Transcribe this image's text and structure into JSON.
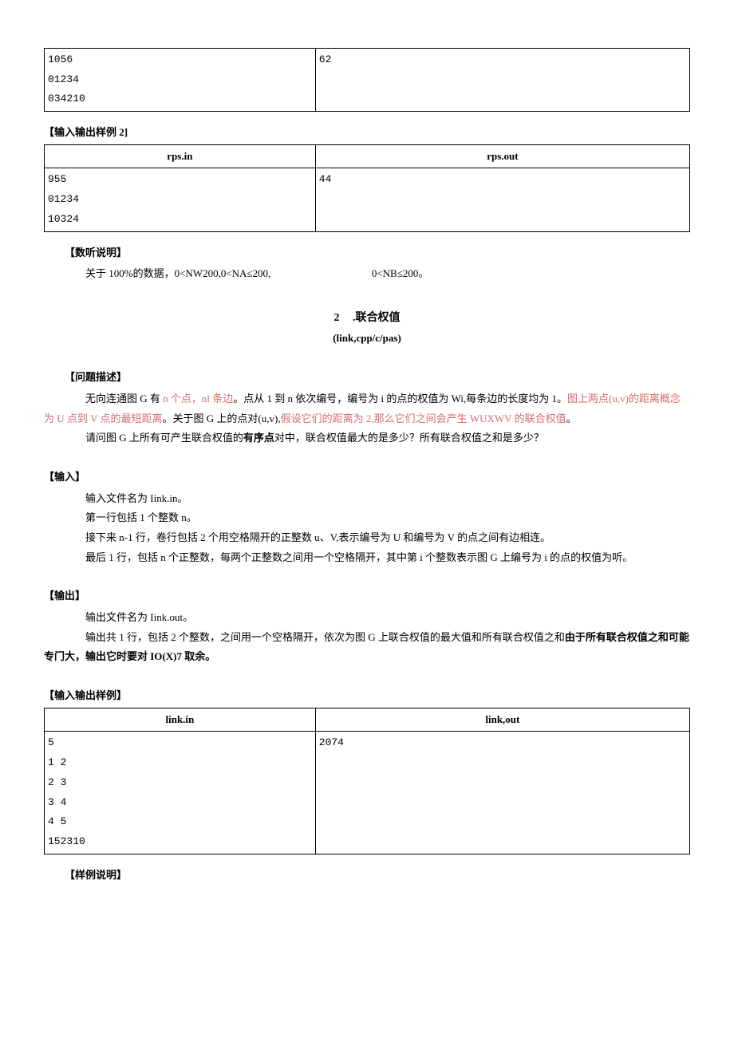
{
  "table1": {
    "in": "1056\n01234\n034210",
    "out": "62"
  },
  "sample2_label": "【输入输出样例 2]",
  "table2": {
    "header_in": "rps.in",
    "header_out": "rps.out",
    "in": "955\n01234\n10324",
    "out": "44"
  },
  "data_desc": {
    "label": "【数听说明】",
    "text_a": "关于 100%的数据，0<NW200,0<NA≤200,",
    "text_b": "0<NB≤200。"
  },
  "problem2": {
    "num": "2",
    "title": ".联合权值",
    "subtitle": "(link,cpp/c/pas)"
  },
  "desc": {
    "label": "【问题描述】",
    "p1a": "无向连通图 G 有 ",
    "p1b": "n 个点，nl 条边",
    "p1c": "。点从 1 到 n 依次编号，编号为 i 的点的权值为 Wi,每条边的长度均为 1。",
    "p1d": "图上两点(u,v)的距离概念为 U 点到 V 点的最短距离",
    "p1e": "。关于图 G 上的点对(u,v),",
    "p1f": "假设它们的距离为 2,那么它们之间会产生 WUXWV 的联合权值",
    "p1g": "。",
    "p2a": "请问图 G 上所有可产生联合权值的",
    "p2b": "有序点",
    "p2c": "对中，联合权值最大的是多少？所有联合权值之和是多少？"
  },
  "input": {
    "label": "【输入】",
    "l1": "输入文件名为 Iink.in。",
    "l2": "第一行包括 1 个整数 n。",
    "l3": "接下来 n-1 行，卷行包括 2 个用空格隔开的正整数 u、V,表示编号为 U 和编号为 V 的点之间有边相连。",
    "l4": "最后 1 行，包括 n 个正整数，每两个正整数之间用一个空格隔开，其中第 i 个整数表示图 G 上编号为 i 的点的权值为听。"
  },
  "output": {
    "label": "【输出】",
    "l1": "输出文件名为 Iink.out。",
    "l2a": "输出共 1 行，包括 2 个整数，之间用一个空格隔开，依次为图 G 上联合权值的最大值和所有联合权值之和",
    "l2b": "由于所有联合权值之和可能专门大，输出它时要对 IO(X)7 取余。"
  },
  "sample3_label": "【输入输出样例】",
  "table3": {
    "header_in": "link.in",
    "header_out": "link,out",
    "in": "5\n1 2\n2 3\n3 4\n4 5\n152310",
    "out": "2074"
  },
  "sample_explain_label": "【样例说明】"
}
